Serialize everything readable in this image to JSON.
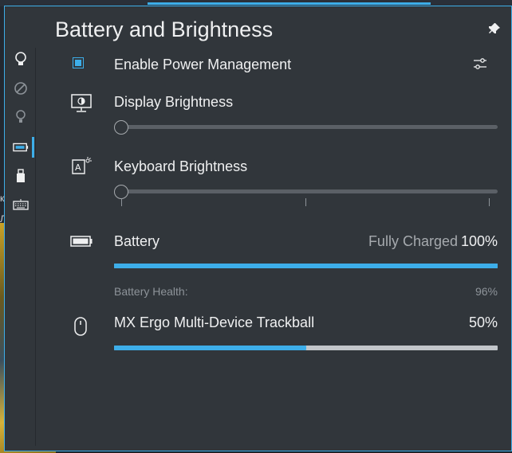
{
  "background": {
    "frag1": "к",
    "frag2": "Л"
  },
  "panel": {
    "title": "Battery and Brightness"
  },
  "sidebar": {
    "items": [
      {
        "icon": "lightbulb-icon"
      },
      {
        "icon": "no-disturb-icon"
      },
      {
        "icon": "lightbulb-dim-icon"
      },
      {
        "icon": "battery-icon"
      },
      {
        "icon": "usb-drive-icon"
      },
      {
        "icon": "keyboard-icon"
      }
    ]
  },
  "power_management": {
    "label": "Enable Power Management",
    "checked": true
  },
  "display_brightness": {
    "label": "Display Brightness",
    "value": 0
  },
  "keyboard_brightness": {
    "label": "Keyboard Brightness",
    "value": 0
  },
  "battery": {
    "label": "Battery",
    "status": "Fully Charged",
    "percent": "100%",
    "level": 1.0,
    "health_label": "Battery Health:",
    "health_value": "96%"
  },
  "device": {
    "label": "MX Ergo Multi-Device Trackball",
    "percent": "50%",
    "level": 0.5
  },
  "colors": {
    "accent": "#3daee9",
    "panel_bg": "#31363b"
  }
}
